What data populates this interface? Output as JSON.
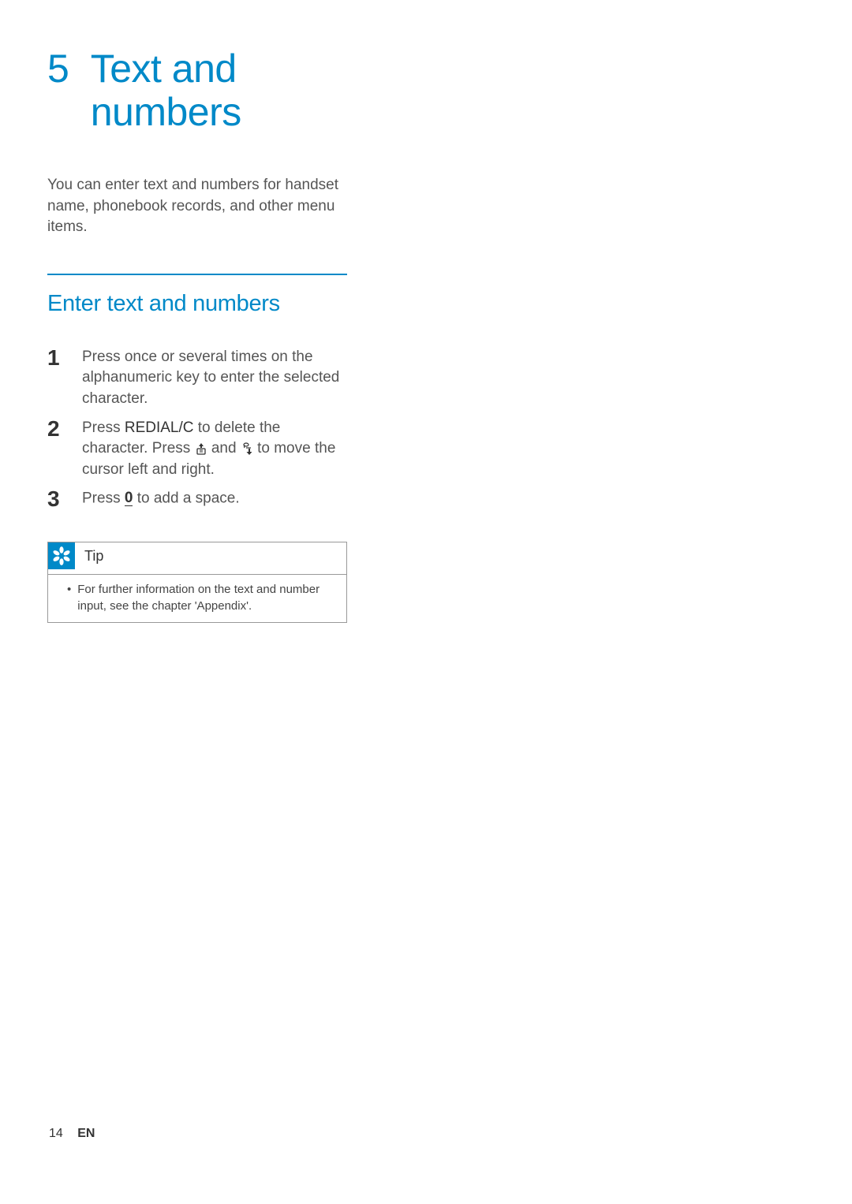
{
  "chapter": {
    "number": "5",
    "title_line1": "Text and",
    "title_line2": "numbers"
  },
  "intro": "You can enter text and numbers for handset name, phonebook records, and other menu items.",
  "section": {
    "heading": "Enter text and numbers"
  },
  "steps": [
    {
      "number": "1",
      "text": "Press once or several times on the alphanumeric key to enter the selected character."
    },
    {
      "number": "2",
      "prefix": "Press ",
      "keyword": "REDIAL/C",
      "mid1": " to delete the character. Press ",
      "mid2": " and ",
      "mid3": " to move the cursor left and right."
    },
    {
      "number": "3",
      "prefix": "Press ",
      "key_zero": "0",
      "suffix": " to add a space."
    }
  ],
  "tip": {
    "label": "Tip",
    "text": "For further information on the text and number input, see the chapter 'Appendix'."
  },
  "footer": {
    "page": "14",
    "lang": "EN"
  }
}
